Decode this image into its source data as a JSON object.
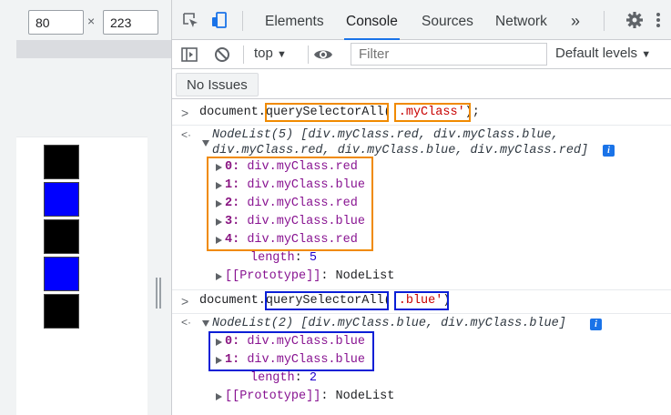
{
  "viewport": {
    "width_value": "80",
    "height_value": "223",
    "times_symbol": "×"
  },
  "devtools": {
    "tabs": [
      "Elements",
      "Console",
      "Sources",
      "Network"
    ],
    "more_tabs": "»",
    "active_tab": "Console",
    "toolbar": {
      "context": "top",
      "filter_placeholder": "Filter",
      "levels": "Default levels"
    },
    "issues_button": "No Issues"
  },
  "console": {
    "cmd1": {
      "object": "document.",
      "method": "querySelectorAll",
      "open_paren": "(",
      "arg": "'.myClass'",
      "close": ");"
    },
    "result1": {
      "summary_line1": "NodeList(5) [div.myClass.red, div.myClass.blue,",
      "summary_line2": "div.myClass.red, div.myClass.blue, div.myClass.red]",
      "info": "i",
      "items": [
        {
          "index": "0",
          "value": "div.myClass.red"
        },
        {
          "index": "1",
          "value": "div.myClass.blue"
        },
        {
          "index": "2",
          "value": "div.myClass.red"
        },
        {
          "index": "3",
          "value": "div.myClass.blue"
        },
        {
          "index": "4",
          "value": "div.myClass.red"
        }
      ],
      "length_key": "length",
      "length_value": "5",
      "proto_key": "[[Prototype]]",
      "proto_value": "NodeList"
    },
    "cmd2": {
      "object": "document.",
      "method": "querySelectorAll",
      "open_paren": "(",
      "arg": "'.blue'",
      "close": ")"
    },
    "result2": {
      "summary": "NodeList(2) [div.myClass.blue, div.myClass.blue]",
      "info": "i",
      "items": [
        {
          "index": "0",
          "value": "div.myClass.blue"
        },
        {
          "index": "1",
          "value": "div.myClass.blue"
        }
      ],
      "length_key": "length",
      "length_value": "2",
      "proto_key": "[[Prototype]]",
      "proto_value": "NodeList"
    }
  },
  "preview_boxes": [
    "black",
    "blue",
    "black",
    "blue",
    "black"
  ],
  "colors": {
    "highlight_orange": "#f08a00",
    "highlight_blue": "#0a1fd6",
    "accent": "#1a73e8"
  }
}
